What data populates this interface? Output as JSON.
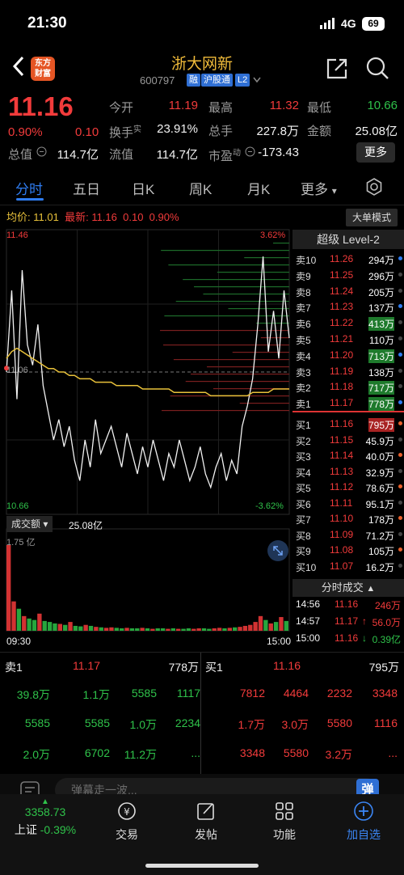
{
  "status_bar": {
    "time": "21:30",
    "network": "4G",
    "battery": "69"
  },
  "header": {
    "logo_text_1": "东方",
    "logo_text_2": "财富",
    "stock_name": "浙大网新",
    "stock_code": "600797",
    "tags": [
      "融",
      "沪股通",
      "L2"
    ]
  },
  "quote": {
    "price": "11.16",
    "change_pct": "0.90%",
    "change_amt": "0.10",
    "total_value_label": "总值",
    "total_value": "114.7亿",
    "fields": [
      {
        "label": "今开",
        "value": "11.19",
        "color": "red"
      },
      {
        "label": "最高",
        "value": "11.32",
        "color": "red"
      },
      {
        "label": "最低",
        "value": "10.66",
        "color": "green"
      },
      {
        "label": "换手",
        "sup": "实",
        "value": "23.91%",
        "color": "white"
      },
      {
        "label": "总手",
        "value": "227.8万",
        "color": "white"
      },
      {
        "label": "金额",
        "value": "25.08亿",
        "color": "white"
      },
      {
        "label": "流值",
        "value": "114.7亿",
        "color": "white"
      },
      {
        "label": "市盈",
        "sup": "动",
        "value": "-173.43",
        "color": "white"
      }
    ],
    "more_label": "更多"
  },
  "tabs": [
    "分时",
    "五日",
    "日K",
    "周K",
    "月K",
    "更多"
  ],
  "avg_bar": {
    "avg_label": "均价:",
    "avg_value": "11.01",
    "latest_label": "最新:",
    "latest_value": "11.16",
    "latest_change": "0.10",
    "latest_pct": "0.90%",
    "big_order_label": "大单模式"
  },
  "chart_data": {
    "type": "line",
    "price_high_label": "11.46",
    "price_low_label": "10.66",
    "mid_label": "11.06",
    "pct_high_label": "3.62%",
    "pct_low_label": "-3.62%",
    "ylim": [
      10.66,
      11.46
    ],
    "time_start": "09:30",
    "time_end": "15:00",
    "price_series": [
      11.06,
      11.3,
      10.98,
      11.36,
      11.14,
      11.08,
      11.2,
      11.02,
      10.94,
      10.86,
      10.92,
      10.84,
      10.9,
      10.8,
      10.74,
      10.86,
      10.78,
      10.92,
      10.82,
      10.86,
      10.9,
      10.84,
      10.78,
      10.88,
      10.82,
      10.76,
      10.84,
      10.78,
      10.86,
      10.8,
      10.74,
      10.82,
      10.78,
      10.86,
      10.8,
      10.74,
      10.78,
      10.84,
      10.76,
      10.72,
      10.78,
      10.82,
      10.74,
      10.8,
      10.76,
      10.9,
      10.96,
      11.04,
      11.2,
      11.4,
      11.12,
      11.24,
      11.1,
      11.3,
      11.16
    ],
    "avg_series": [
      11.1,
      11.12,
      11.13,
      11.12,
      11.11,
      11.1,
      11.09,
      11.08,
      11.07,
      11.07,
      11.06,
      11.06,
      11.05,
      11.05,
      11.04,
      11.04,
      11.04,
      11.03,
      11.03,
      11.03,
      11.03,
      11.02,
      11.02,
      11.02,
      11.02,
      11.02,
      11.01,
      11.01,
      11.01,
      11.01,
      11.01,
      11.01,
      11.0,
      11.0,
      11.0,
      11.0,
      11.0,
      11.0,
      11.0,
      10.99,
      10.99,
      10.99,
      10.99,
      10.99,
      10.99,
      10.99,
      10.99,
      11.0,
      11.0,
      11.0,
      11.0,
      11.01,
      11.01,
      11.01,
      11.01
    ],
    "volume_label": "成交额",
    "volume_total": "25.08亿",
    "volume_max_label": "1.75 亿",
    "volume_series": [
      1.75,
      0.6,
      0.45,
      0.3,
      0.25,
      0.22,
      0.35,
      0.2,
      0.18,
      0.15,
      0.14,
      0.12,
      0.18,
      0.1,
      0.09,
      0.12,
      0.1,
      0.08,
      0.07,
      0.06,
      0.07,
      0.06,
      0.05,
      0.06,
      0.05,
      0.05,
      0.06,
      0.05,
      0.04,
      0.05,
      0.05,
      0.04,
      0.05,
      0.04,
      0.04,
      0.05,
      0.04,
      0.05,
      0.05,
      0.04,
      0.05,
      0.06,
      0.05,
      0.06,
      0.07,
      0.08,
      0.1,
      0.12,
      0.18,
      0.3,
      0.22,
      0.15,
      0.18,
      0.28,
      0.2
    ]
  },
  "level2": {
    "title": "超级 Level-2",
    "asks": [
      {
        "label": "卖10",
        "price": "11.26",
        "vol": "294万"
      },
      {
        "label": "卖9",
        "price": "11.25",
        "vol": "296万"
      },
      {
        "label": "卖8",
        "price": "11.24",
        "vol": "205万"
      },
      {
        "label": "卖7",
        "price": "11.23",
        "vol": "137万"
      },
      {
        "label": "卖6",
        "price": "11.22",
        "vol": "413万"
      },
      {
        "label": "卖5",
        "price": "11.21",
        "vol": "110万"
      },
      {
        "label": "卖4",
        "price": "11.20",
        "vol": "713万"
      },
      {
        "label": "卖3",
        "price": "11.19",
        "vol": "138万"
      },
      {
        "label": "卖2",
        "price": "11.18",
        "vol": "717万"
      },
      {
        "label": "卖1",
        "price": "11.17",
        "vol": "778万"
      }
    ],
    "bids": [
      {
        "label": "买1",
        "price": "11.16",
        "vol": "795万"
      },
      {
        "label": "买2",
        "price": "11.15",
        "vol": "45.9万"
      },
      {
        "label": "买3",
        "price": "11.14",
        "vol": "40.0万"
      },
      {
        "label": "买4",
        "price": "11.13",
        "vol": "32.9万"
      },
      {
        "label": "买5",
        "price": "11.12",
        "vol": "78.6万"
      },
      {
        "label": "买6",
        "price": "11.11",
        "vol": "95.1万"
      },
      {
        "label": "买7",
        "price": "11.10",
        "vol": "178万"
      },
      {
        "label": "买8",
        "price": "11.09",
        "vol": "71.2万"
      },
      {
        "label": "买9",
        "price": "11.08",
        "vol": "105万"
      },
      {
        "label": "买10",
        "price": "11.07",
        "vol": "16.2万"
      }
    ],
    "ticks_title": "分时成交",
    "ticks": [
      {
        "time": "14:56",
        "price": "11.16",
        "vol": "246万"
      },
      {
        "time": "14:57",
        "price": "11.17",
        "vol": "56.0万",
        "arrow": "↑"
      },
      {
        "time": "15:00",
        "price": "11.16",
        "vol": "0.39亿",
        "arrow": "↓"
      }
    ]
  },
  "bottom_book": {
    "sell1_label": "卖1",
    "sell1_price": "11.17",
    "sell1_vol": "778万",
    "buy1_label": "买1",
    "buy1_price": "11.16",
    "buy1_vol": "795万",
    "sell_orders": [
      [
        "39.8万",
        "1.1万",
        "5585",
        "1117"
      ],
      [
        "5585",
        "5585",
        "1.0万",
        "2234"
      ],
      [
        "2.0万",
        "6702",
        "11.2万",
        "..."
      ]
    ],
    "buy_orders": [
      [
        "7812",
        "4464",
        "2232",
        "3348"
      ],
      [
        "1.7万",
        "3.0万",
        "5580",
        "1116"
      ],
      [
        "3348",
        "5580",
        "3.2万",
        "..."
      ]
    ]
  },
  "comment": {
    "placeholder": "弹幕走一波...",
    "danmu_icon_text": "弹"
  },
  "bottom_nav": {
    "index_value": "3358.73",
    "index_name": "上证",
    "index_pct": "-0.39%",
    "items": [
      "交易",
      "发帖",
      "功能",
      "加自选"
    ]
  }
}
